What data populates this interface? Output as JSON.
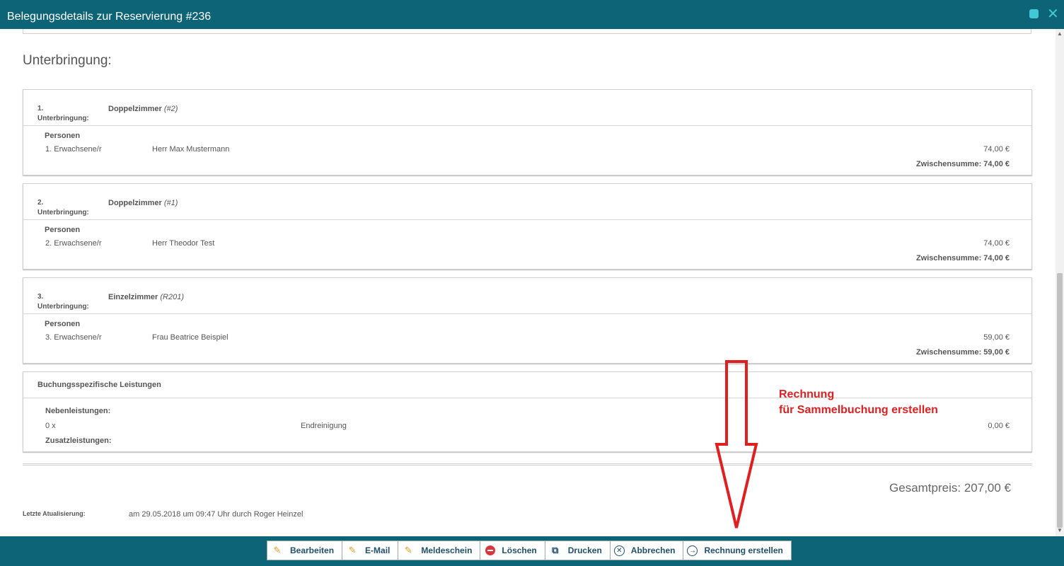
{
  "window": {
    "title": "Belegungsdetails zur Reservierung #236"
  },
  "section_title": "Unterbringung:",
  "accommodations": [
    {
      "num": "1.",
      "label": "Unterbringung:",
      "room": "Doppelzimmer",
      "room_code": "(#2)",
      "persons_label": "Personen",
      "person_type": "1. Erwachsene/r",
      "person_name": "Herr Max Mustermann",
      "price": "74,00 €",
      "subtotal": "Zwischensumme: 74,00 €"
    },
    {
      "num": "2.",
      "label": "Unterbringung:",
      "room": "Doppelzimmer",
      "room_code": "(#1)",
      "persons_label": "Personen",
      "person_type": "2. Erwachsene/r",
      "person_name": "Herr Theodor Test",
      "price": "74,00 €",
      "subtotal": "Zwischensumme: 74,00 €"
    },
    {
      "num": "3.",
      "label": "Unterbringung:",
      "room": "Einzelzimmer",
      "room_code": "(R201)",
      "persons_label": "Personen",
      "person_type": "3. Erwachsene/r",
      "person_name": "Frau Beatrice Beispiel",
      "price": "59,00 €",
      "subtotal": "Zwischensumme: 59,00 €"
    }
  ],
  "services": {
    "title": "Buchungsspezifische Leistungen",
    "neben_label": "Nebenleistungen:",
    "qty": "0 x",
    "name": "Endreinigung",
    "price": "0,00 €",
    "zusatz_label": "Zusatzleistungen:"
  },
  "total": "Gesamtpreis: 207,00 €",
  "last_update": {
    "label": "Letzte Atualisierung:",
    "value": "am 29.05.2018 um 09:47 Uhr durch Roger Heinzel"
  },
  "annotation": {
    "line1": "Rechnung",
    "line2": "für Sammelbuchung erstellen",
    "color": "#e02020"
  },
  "buttons": {
    "edit": "Bearbeiten",
    "email": "E-Mail",
    "meldeschein": "Meldeschein",
    "delete": "Löschen",
    "print": "Drucken",
    "cancel": "Abbrechen",
    "invoice": "Rechnung erstellen"
  },
  "colors": {
    "header": "#0d6476",
    "accent": "#41c9d6"
  }
}
